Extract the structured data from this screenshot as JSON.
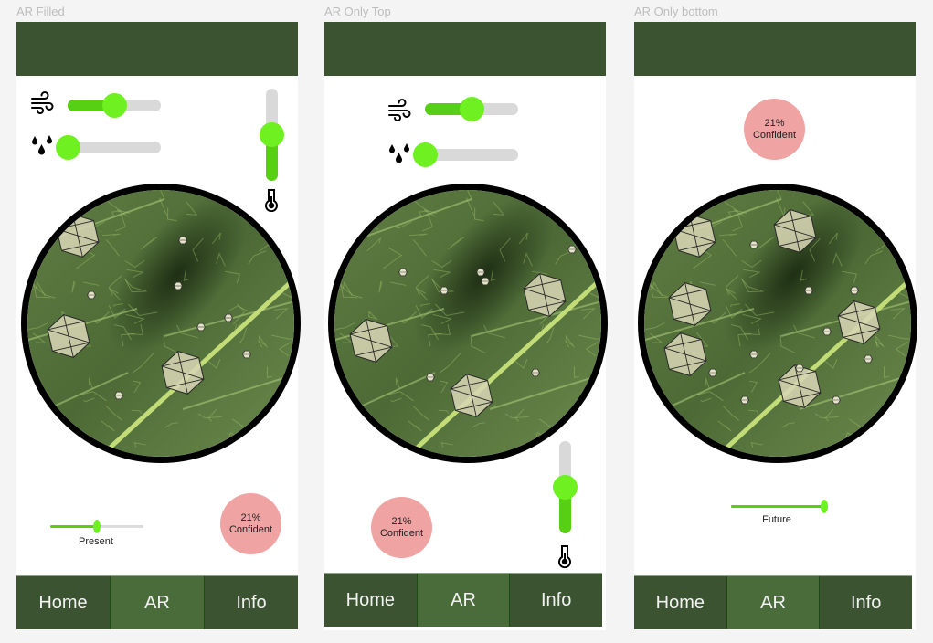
{
  "frames": [
    {
      "label": "AR Filled",
      "wind_slider": {
        "value": 0.5
      },
      "humidity_slider": {
        "value": 0.0
      },
      "temperature_slider": {
        "value": 0.5
      },
      "time_slider": {
        "value": 0.5,
        "label": "Present"
      },
      "confidence": {
        "percent": "21%",
        "label": "Confident"
      },
      "nav": {
        "items": [
          {
            "label": "Home"
          },
          {
            "label": "AR",
            "active": true
          },
          {
            "label": "Info"
          }
        ]
      },
      "overlays": {
        "large": 3,
        "small": 7
      }
    },
    {
      "label": "AR Only Top",
      "wind_slider": {
        "value": 0.5
      },
      "humidity_slider": {
        "value": 0.0
      },
      "temperature_slider": {
        "value": 0.5
      },
      "confidence": {
        "percent": "21%",
        "label": "Confident"
      },
      "nav": {
        "items": [
          {
            "label": "Home"
          },
          {
            "label": "AR",
            "active": true
          },
          {
            "label": "Info"
          }
        ]
      },
      "overlays": {
        "large": 3,
        "small": 7
      }
    },
    {
      "label": "AR Only bottom",
      "time_slider": {
        "value": 1.0,
        "label": "Future"
      },
      "confidence": {
        "percent": "21%",
        "label": "Confident"
      },
      "nav": {
        "items": [
          {
            "label": "Home"
          },
          {
            "label": "AR",
            "active": true
          },
          {
            "label": "Info"
          }
        ]
      },
      "overlays": {
        "large": 6,
        "small": 10
      }
    }
  ],
  "colors": {
    "header": "#3b5330",
    "nav_active": "#4a6b3a",
    "slider_fill": "#57cf12",
    "slider_thumb": "#6ef021",
    "confidence_bubble": "#f0a3a3"
  },
  "icons": {
    "wind": "wind-icon",
    "humidity": "water-drops-icon",
    "temperature": "thermometer-icon"
  }
}
